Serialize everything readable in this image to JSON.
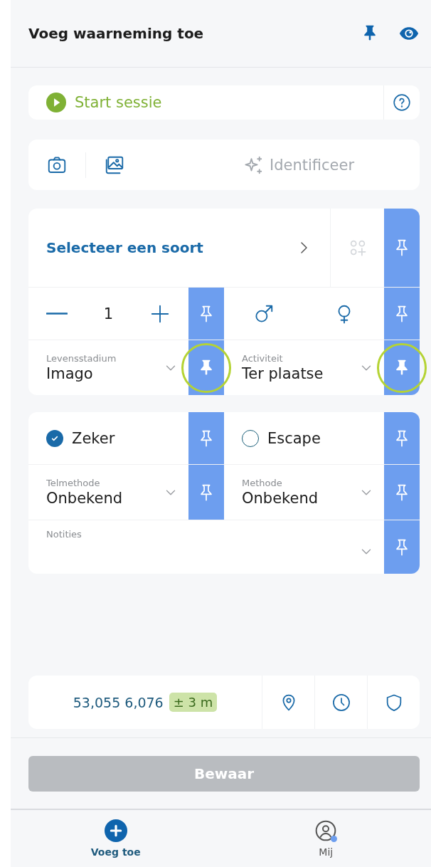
{
  "header": {
    "title": "Voeg waarneming toe"
  },
  "session": {
    "label": "Start sessie"
  },
  "media": {
    "identify_label": "Identificeer",
    "identify_disabled": true
  },
  "species_card": {
    "species": {
      "placeholder": "Selecteer een soort",
      "pinned": false
    },
    "count": {
      "value": "1",
      "pinned": false
    },
    "sex": {
      "pinned": false
    },
    "life_stage": {
      "label": "Levensstadium",
      "value": "Imago",
      "pinned": true,
      "highlighted": true
    },
    "activity": {
      "label": "Activiteit",
      "value": "Ter plaatse",
      "pinned": true,
      "highlighted": true
    }
  },
  "details_card": {
    "certain": {
      "label": "Zeker",
      "checked": true,
      "pinned": false
    },
    "escape": {
      "label": "Escape",
      "checked": false,
      "pinned": false
    },
    "count_method": {
      "label": "Telmethode",
      "value": "Onbekend",
      "pinned": false
    },
    "method": {
      "label": "Methode",
      "value": "Onbekend",
      "pinned": false
    },
    "notes": {
      "label": "Notities",
      "pinned": false
    }
  },
  "location": {
    "coordinates": "53,055 6,076",
    "accuracy": "± 3 m"
  },
  "save": {
    "label": "Bewaar",
    "disabled": true
  },
  "nav": [
    {
      "kind": "add",
      "label": "Voeg toe",
      "selected": true,
      "notification": false
    },
    {
      "kind": "profile",
      "label": "Mij",
      "selected": false,
      "notification": true
    }
  ]
}
